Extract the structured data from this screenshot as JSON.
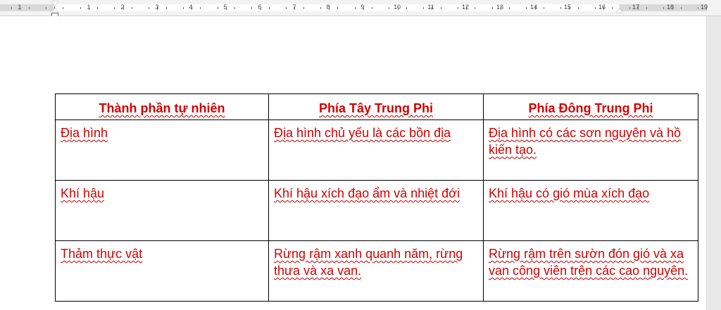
{
  "ruler": {
    "labels": [
      "1",
      "1",
      "2",
      "3",
      "4",
      "5",
      "6",
      "7",
      "8",
      "9",
      "10",
      "11",
      "12",
      "13",
      "14",
      "15",
      "16",
      "17",
      "18",
      "19"
    ]
  },
  "table": {
    "headers": [
      "Thành phần tự nhiên",
      "Phía Tây Trung Phi",
      "Phía Đông Trung Phi"
    ],
    "rows": [
      [
        "Địa hình",
        "Địa hình chủ yếu là các bồn địa",
        "Địa hình có các sơn nguyên và hồ kiến tạo."
      ],
      [
        "Khí hậu",
        "Khí hậu xích đạo ẩm và nhiệt đới",
        "Khí hậu có gió mùa xích đạo"
      ],
      [
        "Thảm thực vật",
        "Rừng rậm xanh quanh năm, rừng thưa và xa van.",
        "Rừng rậm trên sườn đón gió và xa van công viên trên các cao nguyên."
      ]
    ]
  },
  "colors": {
    "text": "#d40000",
    "border": "#000000",
    "page": "#ffffff",
    "background": "#e6e6e6"
  }
}
